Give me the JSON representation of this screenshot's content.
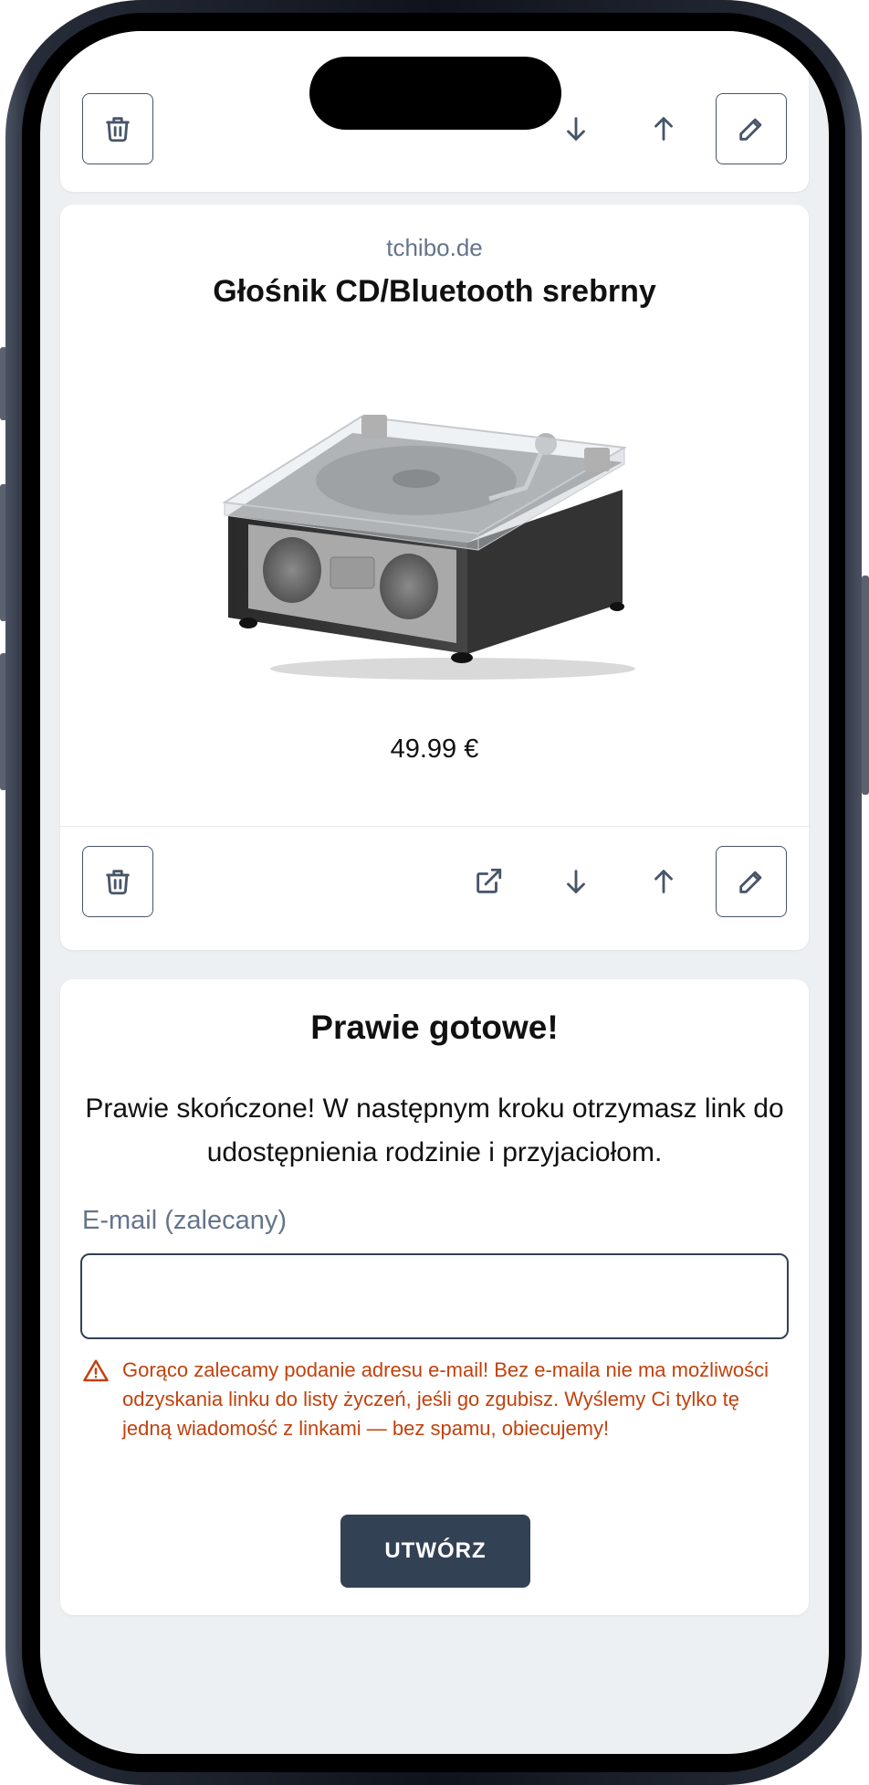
{
  "card_top": {
    "delete_icon": "trash-icon",
    "down_icon": "arrow-down-icon",
    "up_icon": "arrow-up-icon",
    "edit_icon": "pencil-icon"
  },
  "product": {
    "store": "tchibo.de",
    "title": "Głośnik CD/Bluetooth srebrny",
    "price": "49.99 €",
    "delete_icon": "trash-icon",
    "open_icon": "external-link-icon",
    "down_icon": "arrow-down-icon",
    "up_icon": "arrow-up-icon",
    "edit_icon": "pencil-icon"
  },
  "finish": {
    "heading": "Prawie gotowe!",
    "description": "Prawie skończone! W następnym kroku otrzymasz link do udostępnienia rodzinie i przyjaciołom.",
    "email_label": "E-mail (zalecany)",
    "email_value": "",
    "warning_icon": "warning-triangle-icon",
    "warning_text": "Gorąco zalecamy podanie adresu e-mail! Bez e-maila nie ma możliwości odzyskania linku do listy życzeń, jeśli go zgubisz. Wyślemy Ci tylko tę jedną wiadomość z linkami — bez spamu, obiecujemy!",
    "submit_label": "UTWÓRZ"
  },
  "colors": {
    "primary": "#334155",
    "warning": "#c2410c",
    "muted": "#64748b",
    "background": "#edf0f2"
  }
}
